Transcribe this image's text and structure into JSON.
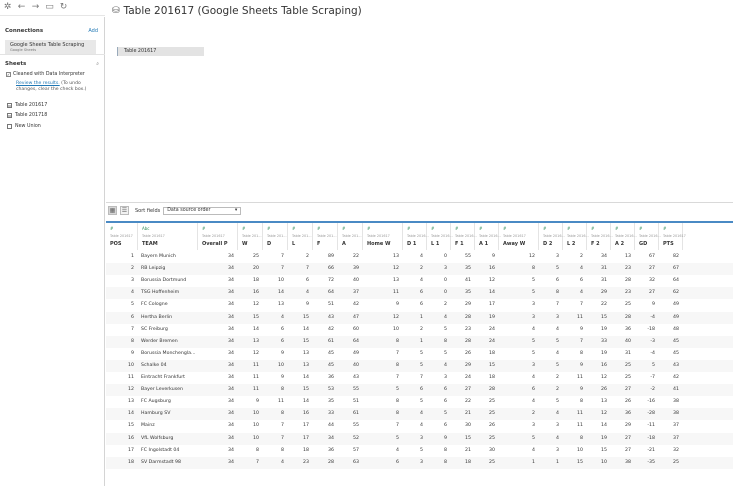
{
  "window": {
    "title": "Table 201617 (Google Sheets Table Scraping)"
  },
  "connections": {
    "heading": "Connections",
    "add_label": "Add",
    "items": [
      {
        "name": "Google Sheets Table Scraping",
        "sub": "Google Sheets"
      }
    ]
  },
  "sheets": {
    "heading": "Sheets",
    "interpreter_label": "Cleaned with Data Interpreter",
    "review_link": "Review the results.",
    "review_note": " (To undo changes, clear the check box.)",
    "items": [
      "Table 201617",
      "Table 201718"
    ],
    "new_union": "New Union"
  },
  "canvas": {
    "table_label": "Table 201617"
  },
  "grid_toolbar": {
    "sort_label": "Sort fields",
    "sort_value": "Data source order"
  },
  "grid": {
    "columns": [
      {
        "src": "Table 201617",
        "name": "POS",
        "type": "number"
      },
      {
        "src": "Table 201617",
        "name": "TEAM",
        "type": "text"
      },
      {
        "src": "Table 201617",
        "name": "Overall P",
        "type": "number"
      },
      {
        "src": "Table 201...",
        "name": "W",
        "type": "number"
      },
      {
        "src": "Table 201...",
        "name": "D",
        "type": "number"
      },
      {
        "src": "Table 201...",
        "name": "L",
        "type": "number"
      },
      {
        "src": "Table 201...",
        "name": "F",
        "type": "number"
      },
      {
        "src": "Table 201...",
        "name": "A",
        "type": "number"
      },
      {
        "src": "Table 201617",
        "name": "Home W",
        "type": "number"
      },
      {
        "src": "Table 2016...",
        "name": "D 1",
        "type": "number"
      },
      {
        "src": "Table 2016...",
        "name": "L 1",
        "type": "number"
      },
      {
        "src": "Table 2016...",
        "name": "F 1",
        "type": "number"
      },
      {
        "src": "Table 2016...",
        "name": "A 1",
        "type": "number"
      },
      {
        "src": "Table 201617",
        "name": "Away W",
        "type": "number"
      },
      {
        "src": "Table 2016...",
        "name": "D 2",
        "type": "number"
      },
      {
        "src": "Table 2016...",
        "name": "L 2",
        "type": "number"
      },
      {
        "src": "Table 2016...",
        "name": "F 2",
        "type": "number"
      },
      {
        "src": "Table 2016...",
        "name": "A 2",
        "type": "number"
      },
      {
        "src": "Table 2016...",
        "name": "GD",
        "type": "number"
      },
      {
        "src": "Table 201617",
        "name": "PTS",
        "type": "number"
      }
    ],
    "rows": [
      [
        "1",
        "Bayern Munich",
        "34",
        "25",
        "7",
        "2",
        "89",
        "22",
        "13",
        "4",
        "0",
        "55",
        "9",
        "12",
        "3",
        "2",
        "34",
        "13",
        "67",
        "82"
      ],
      [
        "2",
        "RB Leipzig",
        "34",
        "20",
        "7",
        "7",
        "66",
        "39",
        "12",
        "2",
        "3",
        "35",
        "16",
        "8",
        "5",
        "4",
        "31",
        "23",
        "27",
        "67"
      ],
      [
        "3",
        "Borussia Dortmund",
        "34",
        "18",
        "10",
        "6",
        "72",
        "40",
        "13",
        "4",
        "0",
        "41",
        "12",
        "5",
        "6",
        "6",
        "31",
        "28",
        "32",
        "64"
      ],
      [
        "4",
        "TSG Hoffenheim",
        "34",
        "16",
        "14",
        "4",
        "64",
        "37",
        "11",
        "6",
        "0",
        "35",
        "14",
        "5",
        "8",
        "4",
        "29",
        "23",
        "27",
        "62"
      ],
      [
        "5",
        "FC Cologne",
        "34",
        "12",
        "13",
        "9",
        "51",
        "42",
        "9",
        "6",
        "2",
        "29",
        "17",
        "3",
        "7",
        "7",
        "22",
        "25",
        "9",
        "49"
      ],
      [
        "6",
        "Hertha Berlin",
        "34",
        "15",
        "4",
        "15",
        "43",
        "47",
        "12",
        "1",
        "4",
        "28",
        "19",
        "3",
        "3",
        "11",
        "15",
        "28",
        "-4",
        "49"
      ],
      [
        "7",
        "SC Freiburg",
        "34",
        "14",
        "6",
        "14",
        "42",
        "60",
        "10",
        "2",
        "5",
        "23",
        "24",
        "4",
        "4",
        "9",
        "19",
        "36",
        "-18",
        "48"
      ],
      [
        "8",
        "Werder Bremen",
        "34",
        "13",
        "6",
        "15",
        "61",
        "64",
        "8",
        "1",
        "8",
        "28",
        "24",
        "5",
        "5",
        "7",
        "33",
        "40",
        "-3",
        "45"
      ],
      [
        "9",
        "Borussia Monchengla...",
        "34",
        "12",
        "9",
        "13",
        "45",
        "49",
        "7",
        "5",
        "5",
        "26",
        "18",
        "5",
        "4",
        "8",
        "19",
        "31",
        "-4",
        "45"
      ],
      [
        "10",
        "Schalke 04",
        "34",
        "11",
        "10",
        "13",
        "45",
        "40",
        "8",
        "5",
        "4",
        "29",
        "15",
        "3",
        "5",
        "9",
        "16",
        "25",
        "5",
        "43"
      ],
      [
        "11",
        "Eintracht Frankfurt",
        "34",
        "11",
        "9",
        "14",
        "36",
        "43",
        "7",
        "7",
        "3",
        "24",
        "18",
        "4",
        "2",
        "11",
        "12",
        "25",
        "-7",
        "42"
      ],
      [
        "12",
        "Bayer Leverkusen",
        "34",
        "11",
        "8",
        "15",
        "53",
        "55",
        "5",
        "6",
        "6",
        "27",
        "28",
        "6",
        "2",
        "9",
        "26",
        "27",
        "-2",
        "41"
      ],
      [
        "13",
        "FC Augsburg",
        "34",
        "9",
        "11",
        "14",
        "35",
        "51",
        "8",
        "5",
        "6",
        "22",
        "25",
        "4",
        "5",
        "8",
        "13",
        "26",
        "-16",
        "38"
      ],
      [
        "14",
        "Hamburg SV",
        "34",
        "10",
        "8",
        "16",
        "33",
        "61",
        "8",
        "4",
        "5",
        "21",
        "25",
        "2",
        "4",
        "11",
        "12",
        "36",
        "-28",
        "38"
      ],
      [
        "15",
        "Mainz",
        "34",
        "10",
        "7",
        "17",
        "44",
        "55",
        "7",
        "4",
        "6",
        "30",
        "26",
        "3",
        "3",
        "11",
        "14",
        "29",
        "-11",
        "37"
      ],
      [
        "16",
        "VfL Wolfsburg",
        "34",
        "10",
        "7",
        "17",
        "34",
        "52",
        "5",
        "3",
        "9",
        "15",
        "25",
        "5",
        "4",
        "8",
        "19",
        "27",
        "-18",
        "37"
      ],
      [
        "17",
        "FC Ingolstadt 04",
        "34",
        "8",
        "8",
        "18",
        "36",
        "57",
        "4",
        "5",
        "8",
        "21",
        "30",
        "4",
        "3",
        "10",
        "15",
        "27",
        "-21",
        "32"
      ],
      [
        "18",
        "SV Darmstadt 98",
        "34",
        "7",
        "4",
        "23",
        "28",
        "63",
        "6",
        "3",
        "8",
        "18",
        "25",
        "1",
        "1",
        "15",
        "10",
        "38",
        "-35",
        "25"
      ]
    ]
  }
}
